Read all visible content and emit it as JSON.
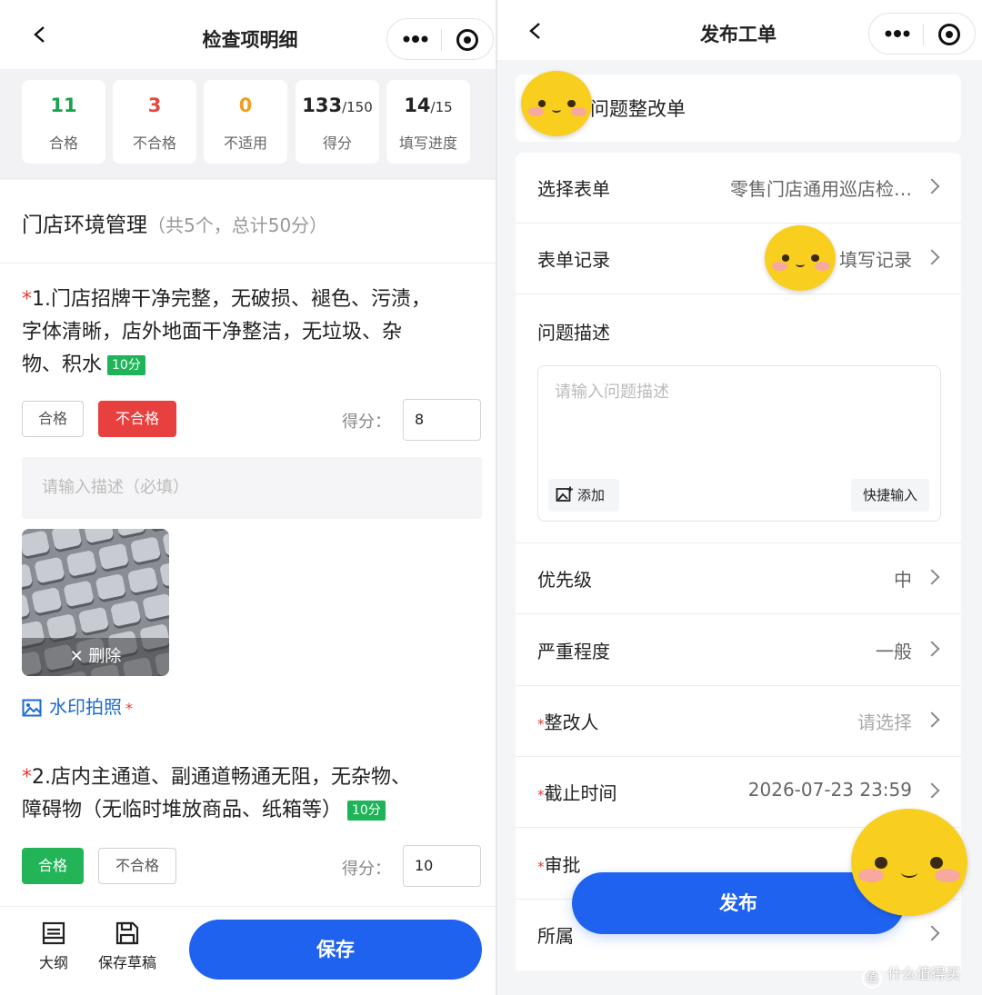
{
  "left": {
    "title": "检查项明细",
    "stats": [
      {
        "value": "11",
        "sub": "",
        "label": "合格",
        "color": "#1aa34a"
      },
      {
        "value": "3",
        "sub": "",
        "label": "不合格",
        "color": "#e5483f"
      },
      {
        "value": "0",
        "sub": "",
        "label": "不适用",
        "color": "#f0a020"
      },
      {
        "value": "133",
        "sub": "/150",
        "label": "得分",
        "color": "#222222"
      },
      {
        "value": "14",
        "sub": "/15",
        "label": "填写进度",
        "color": "#222222"
      }
    ],
    "section": {
      "title": "门店环境管理",
      "summary": "（共5个，总计50分）"
    },
    "items": [
      {
        "star": "*",
        "lines": [
          "1.门店招牌干净完整，无破损、褪色、污渍，",
          "字体清晰，店外地面干净整洁，无垃圾、杂",
          "物、积水"
        ],
        "points": "10分",
        "pass_label": "合格",
        "fail_label": "不合格",
        "score_label": "得分：",
        "score": "8"
      },
      {
        "star": "*",
        "lines": [
          "2.店内主通道、副通道畅通无阻，无杂物、",
          "障碍物（无临时堆放商品、纸箱等）"
        ],
        "points": "10分",
        "pass_label": "合格",
        "fail_label": "不合格",
        "score_label": "得分：",
        "score": "10"
      }
    ],
    "desc_placeholder": "请输入描述（必填）",
    "photo_delete": "✕  删除",
    "watermark_label": "水印拍照",
    "watermark_star": "*",
    "toolbar": {
      "outline": "大纲",
      "draft": "保存草稿",
      "save": "保存"
    }
  },
  "right": {
    "title": "发布工单",
    "ticket_title": "问题整改单",
    "rows": [
      {
        "key": "选择表单",
        "value": "零售门店通用巡店检…",
        "placeholder": false,
        "required": false
      },
      {
        "key": "表单记录",
        "value": "填写记录",
        "placeholder": false,
        "required": false
      }
    ],
    "issue_label": "问题描述",
    "issue_placeholder": "请输入问题描述",
    "add_label": "添加",
    "quick_label": "快捷输入",
    "rows2": [
      {
        "key": "优先级",
        "value": "中",
        "required": false
      },
      {
        "key": "严重程度",
        "value": "一般",
        "required": false
      },
      {
        "key": "整改人",
        "value": "请选择",
        "required": true
      },
      {
        "key": "截止时间",
        "value": "2026-07-23 23:59",
        "required": true
      }
    ],
    "approver_partial": "审批",
    "belong_partial": "所属",
    "publish": "发布"
  },
  "watermark_logo": "什么值得买",
  "watermark_logo_glyph": "值"
}
